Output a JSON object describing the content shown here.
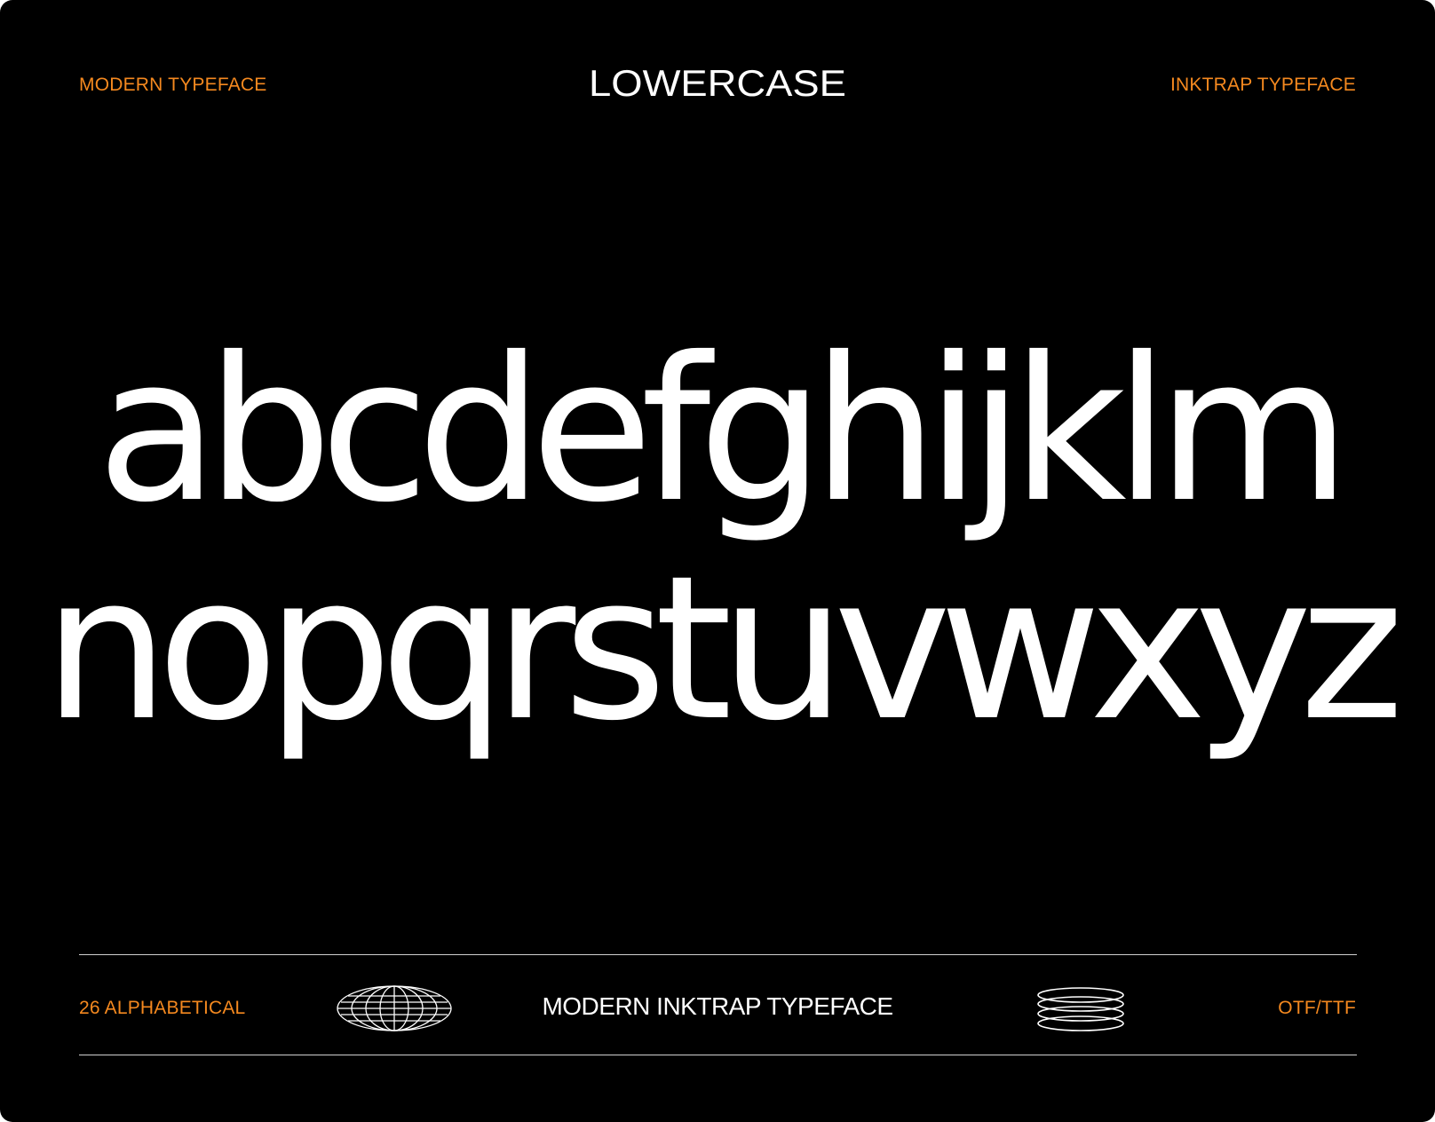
{
  "header": {
    "left_label": "MODERN TYPEFACE",
    "title": "LOWERCASE",
    "right_label": "INKTRAP TYPEFACE"
  },
  "specimen": {
    "row_1": "abcdefghijklm",
    "row_2": "nopqrstuvwxyz"
  },
  "footer": {
    "left_label": "26 ALPHABETICAL",
    "center_label": "MODERN INKTRAP TYPEFACE",
    "right_label": "OTF/TTF",
    "left_icon": "wireframe-globe-icon",
    "right_icon": "stacked-rings-icon"
  },
  "colors": {
    "background": "#000000",
    "accent": "#f5891f",
    "text": "#ffffff"
  }
}
